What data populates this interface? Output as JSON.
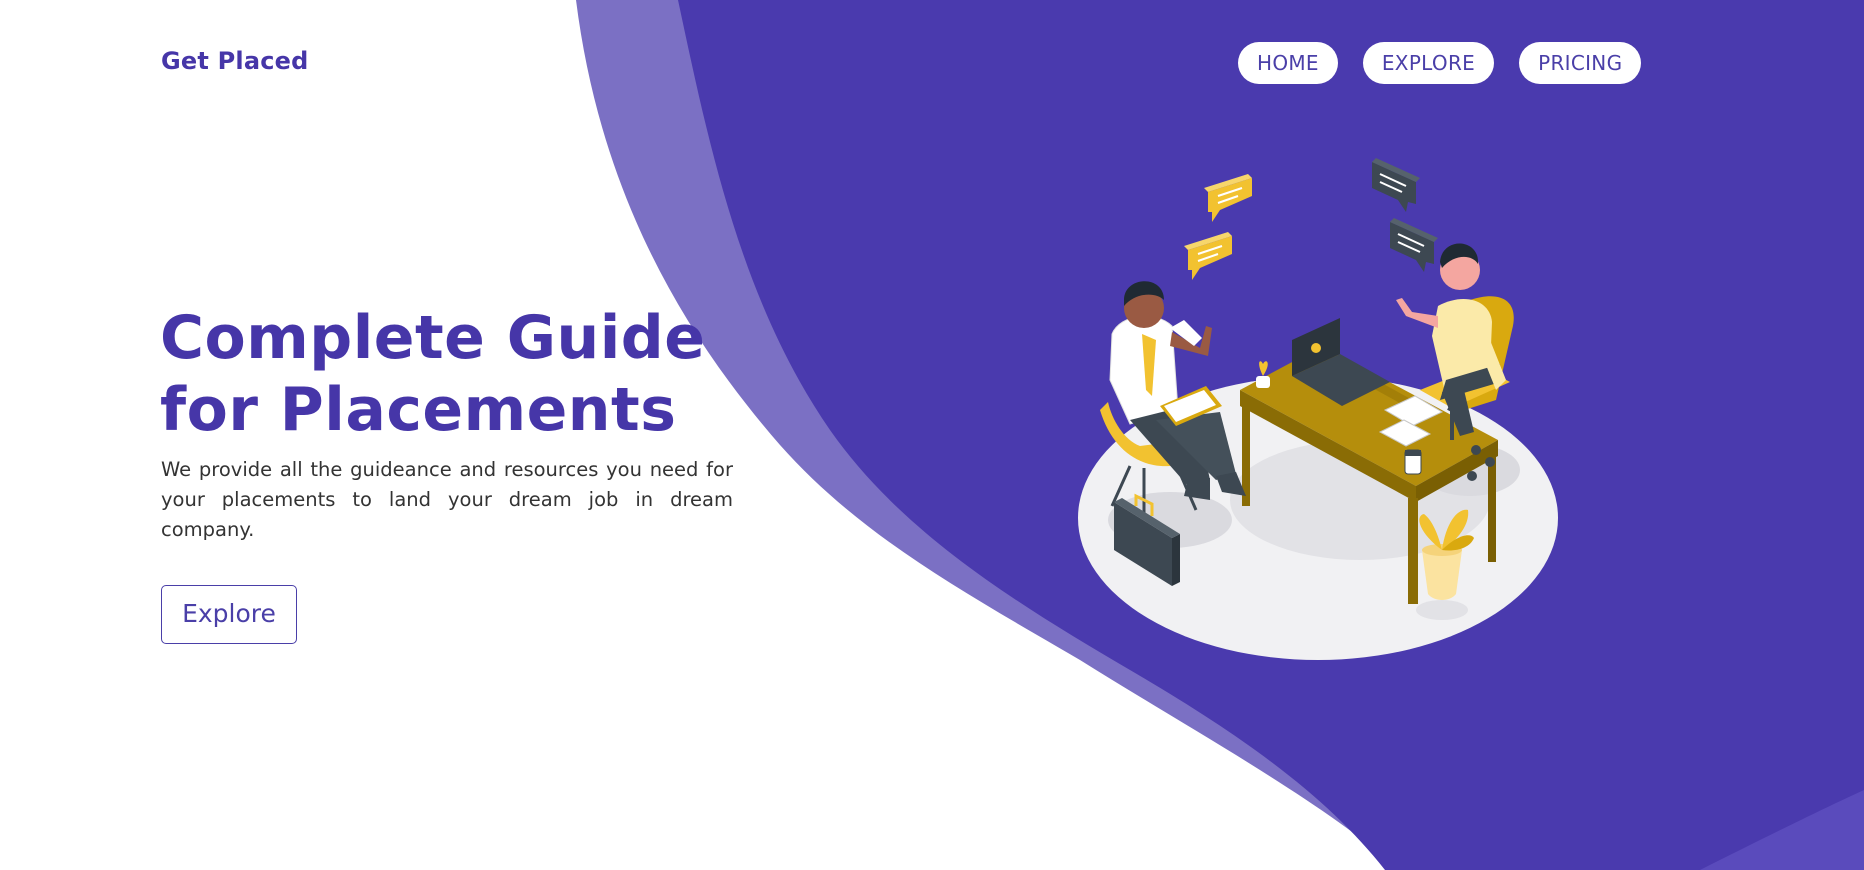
{
  "brand": {
    "name": "Get Placed"
  },
  "nav": {
    "items": [
      "HOME",
      "EXPLORE",
      "PRICING"
    ]
  },
  "hero": {
    "title_line1": "Complete Guide",
    "title_line2": "for Placements",
    "description": "We provide all the guideance and resources you need for your placements to land your dream job in dream company.",
    "cta_label": "Explore"
  },
  "colors": {
    "primary": "#4a3aae",
    "primary_light": "#7b70c4",
    "background": "#ffffff",
    "accent_yellow": "#f2c230"
  },
  "illustration": {
    "subject": "job-interview-illustration"
  }
}
